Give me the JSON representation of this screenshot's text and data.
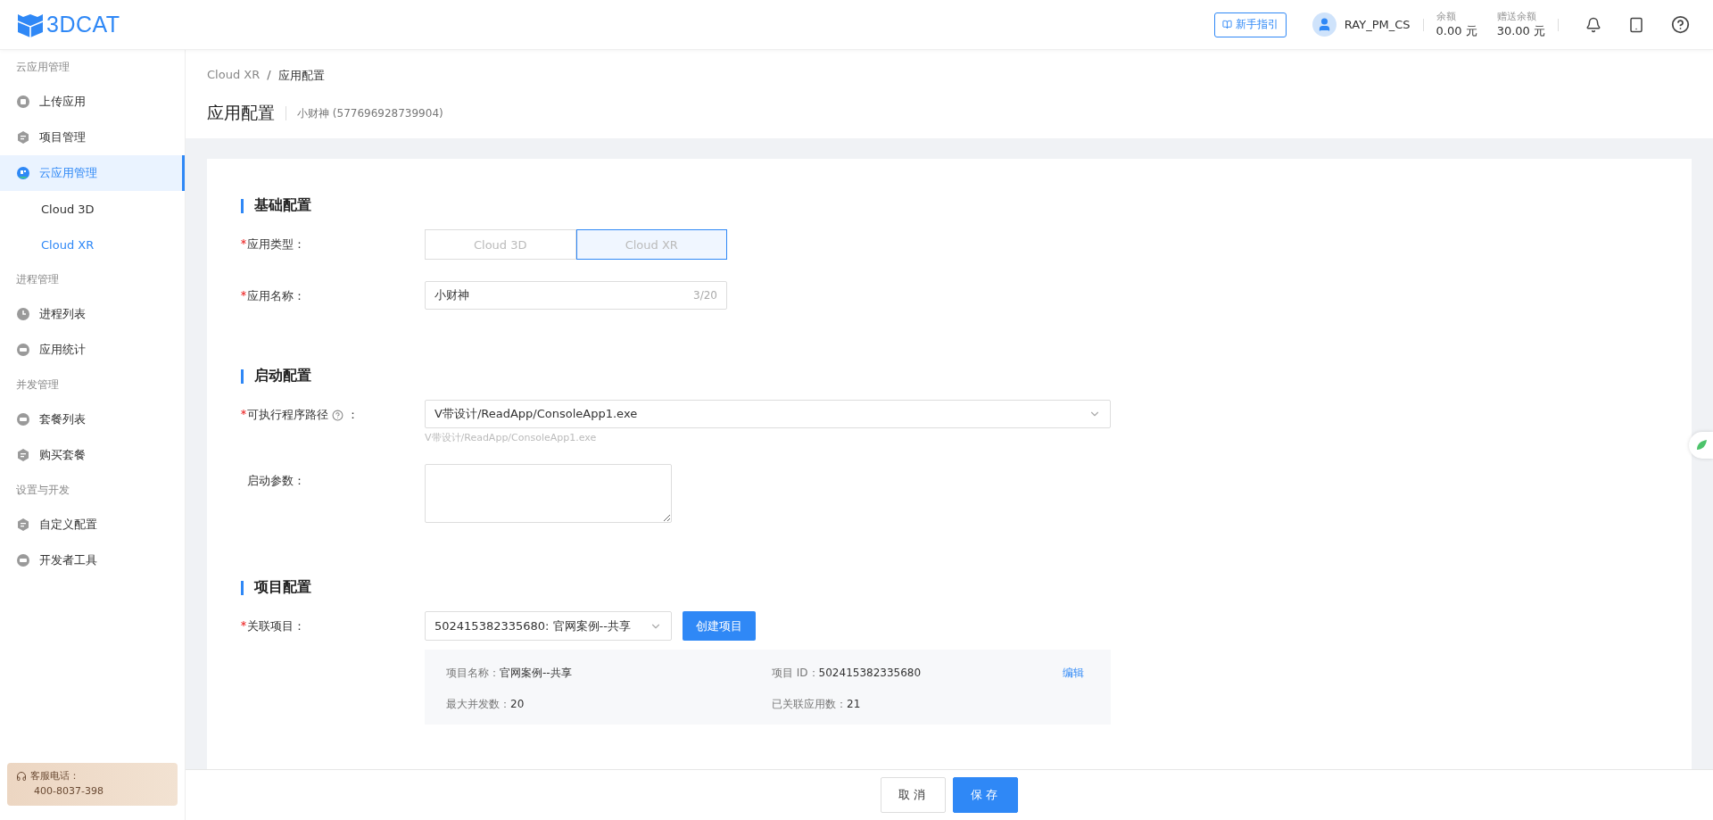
{
  "header": {
    "logo": "3DCAT",
    "guide_button": "新手指引",
    "username": "RAY_PM_CS",
    "balances": [
      {
        "label": "余额",
        "value": "0.00 元"
      },
      {
        "label": "赠送余额",
        "value": "30.00 元"
      }
    ]
  },
  "sidebar": {
    "groups": [
      {
        "title": "云应用管理",
        "items": [
          {
            "label": "上传应用",
            "selected": false
          },
          {
            "label": "项目管理",
            "selected": false
          },
          {
            "label": "云应用管理",
            "selected": true,
            "children": [
              {
                "label": "Cloud 3D",
                "selected": false
              },
              {
                "label": "Cloud XR",
                "selected": true
              }
            ]
          }
        ]
      },
      {
        "title": "进程管理",
        "items": [
          {
            "label": "进程列表",
            "selected": false
          },
          {
            "label": "应用统计",
            "selected": false
          }
        ]
      },
      {
        "title": "并发管理",
        "items": [
          {
            "label": "套餐列表",
            "selected": false
          },
          {
            "label": "购买套餐",
            "selected": false
          }
        ]
      },
      {
        "title": "设置与开发",
        "items": [
          {
            "label": "自定义配置",
            "selected": false
          },
          {
            "label": "开发者工具",
            "selected": false
          }
        ]
      }
    ],
    "hotline": {
      "label": "客服电话：",
      "number": "400-8037-398"
    }
  },
  "breadcrumb": {
    "items": [
      "Cloud XR",
      "应用配置"
    ],
    "separator": "/"
  },
  "page": {
    "title": "应用配置",
    "subtitle": "小财神 (577696928739904)"
  },
  "sections": [
    {
      "title": "基础配置",
      "fields": [
        {
          "kind": "segmented",
          "label": "应用类型：",
          "required": true,
          "options": [
            {
              "label": "Cloud 3D",
              "selected": false
            },
            {
              "label": "Cloud XR",
              "selected": true
            }
          ]
        },
        {
          "kind": "text",
          "label": "应用名称：",
          "required": true,
          "value": "小财神",
          "counter": "3/20"
        }
      ]
    },
    {
      "title": "启动配置",
      "fields": [
        {
          "kind": "select",
          "label": "可执行程序路径",
          "colon": "：",
          "help": true,
          "required": true,
          "value": "V带设计/ReadApp/ConsoleApp1.exe",
          "hint": "V带设计/ReadApp/ConsoleApp1.exe"
        },
        {
          "kind": "textarea",
          "label": "启动参数：",
          "required": false
        }
      ]
    },
    {
      "title": "项目配置",
      "fields": [
        {
          "kind": "project",
          "label": "关联项目：",
          "required": true,
          "value": "502415382335680: 官网案例--共享",
          "button": "创建项目",
          "details": [
            {
              "label": "项目名称：",
              "value": "官网案例--共享"
            },
            {
              "label": "项目 ID：",
              "value": "502415382335680"
            },
            {
              "label": "最大并发数：",
              "value": "20"
            },
            {
              "label": "已关联应用数：",
              "value": "21"
            }
          ],
          "edit_link": "编辑"
        }
      ]
    }
  ],
  "footer": {
    "buttons": [
      {
        "label": "取消",
        "kind": "secondary"
      },
      {
        "label": "保存",
        "kind": "primary"
      }
    ]
  }
}
